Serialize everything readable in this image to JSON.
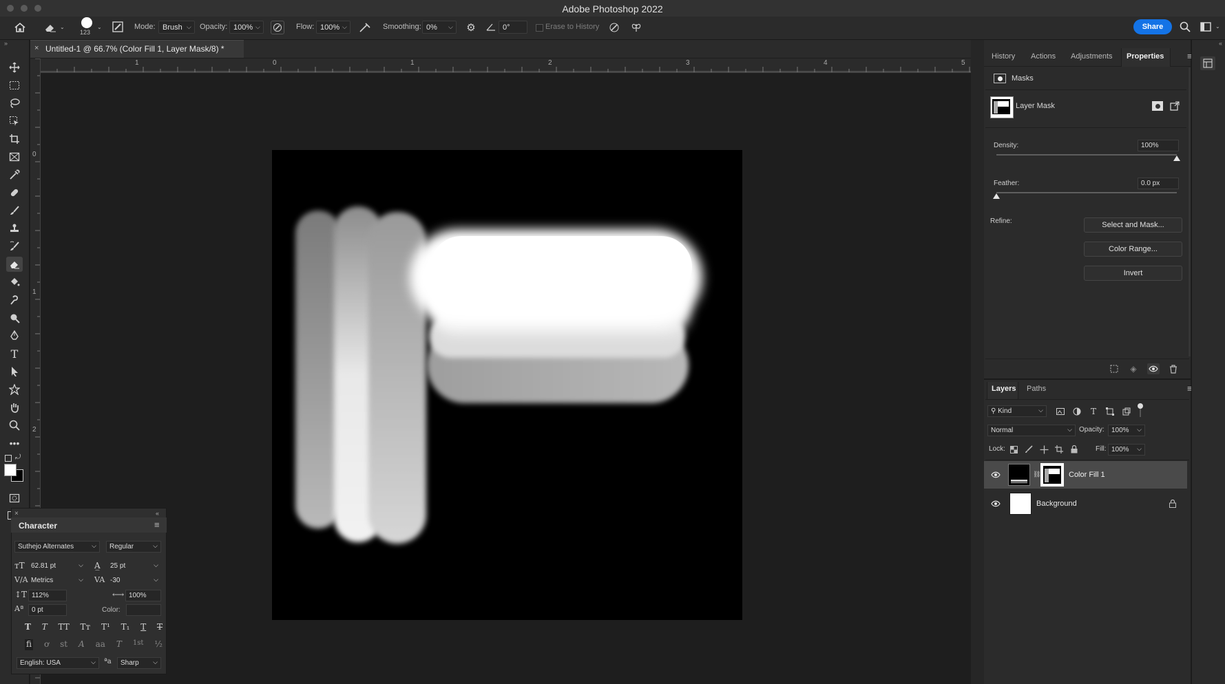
{
  "app": {
    "title": "Adobe Photoshop 2022",
    "share_label": "Share"
  },
  "options_bar": {
    "brush_size": "123",
    "mode_label": "Mode:",
    "mode_value": "Brush",
    "opacity_label": "Opacity:",
    "opacity_value": "100%",
    "flow_label": "Flow:",
    "flow_value": "100%",
    "smoothing_label": "Smoothing:",
    "smoothing_value": "0%",
    "angle_value": "0°",
    "erase_to_history": "Erase to History"
  },
  "document": {
    "tab_title": "Untitled-1 @ 66.7% (Color Fill 1, Layer Mask/8) *"
  },
  "rulers": {
    "top_labels": [
      "1",
      "0",
      "1",
      "2",
      "3",
      "4",
      "5"
    ],
    "left_labels": [
      "0",
      "1",
      "2"
    ]
  },
  "character_panel": {
    "title": "Character",
    "font_family": "Suthejo Alternates",
    "font_style": "Regular",
    "font_size": "62.81 pt",
    "leading": "25 pt",
    "kerning": "Metrics",
    "tracking": "-30",
    "vertical_scale": "112%",
    "horizontal_scale": "100%",
    "baseline_shift": "0 pt",
    "color_label": "Color:",
    "language": "English: USA",
    "antialias": "Sharp",
    "style_buttons": [
      "T",
      "T",
      "TT",
      "Tт",
      "T¹",
      "T₁",
      "T",
      "T"
    ],
    "opentype_buttons": [
      "fi",
      "ơ",
      "st",
      "A",
      "aa",
      "T",
      "1st",
      "½"
    ]
  },
  "properties_panel": {
    "tabs": [
      "History",
      "Actions",
      "Adjustments",
      "Properties"
    ],
    "active_tab": "Properties",
    "section_title": "Masks",
    "mask_type": "Layer Mask",
    "density_label": "Density:",
    "density_value": "100%",
    "density": 1.0,
    "feather_label": "Feather:",
    "feather_value": "0.0 px",
    "feather": 0.0,
    "refine_label": "Refine:",
    "buttons": [
      "Select and Mask...",
      "Color Range...",
      "Invert"
    ]
  },
  "layers_panel": {
    "tabs": [
      "Layers",
      "Paths"
    ],
    "active_tab": "Layers",
    "filter_kind": "Kind",
    "blend_mode": "Normal",
    "opacity_label": "Opacity:",
    "opacity_value": "100%",
    "lock_label": "Lock:",
    "fill_label": "Fill:",
    "fill_value": "100%",
    "layers": [
      {
        "name": "Color Fill 1",
        "visible": true,
        "selected": true
      },
      {
        "name": "Background",
        "visible": true,
        "locked": true
      }
    ]
  },
  "colors": {
    "accent": "#1473e6",
    "panel_bg": "#2b2b2b",
    "workspace_bg": "#1e1e1e",
    "selected_layer": "#4a4a4a"
  }
}
